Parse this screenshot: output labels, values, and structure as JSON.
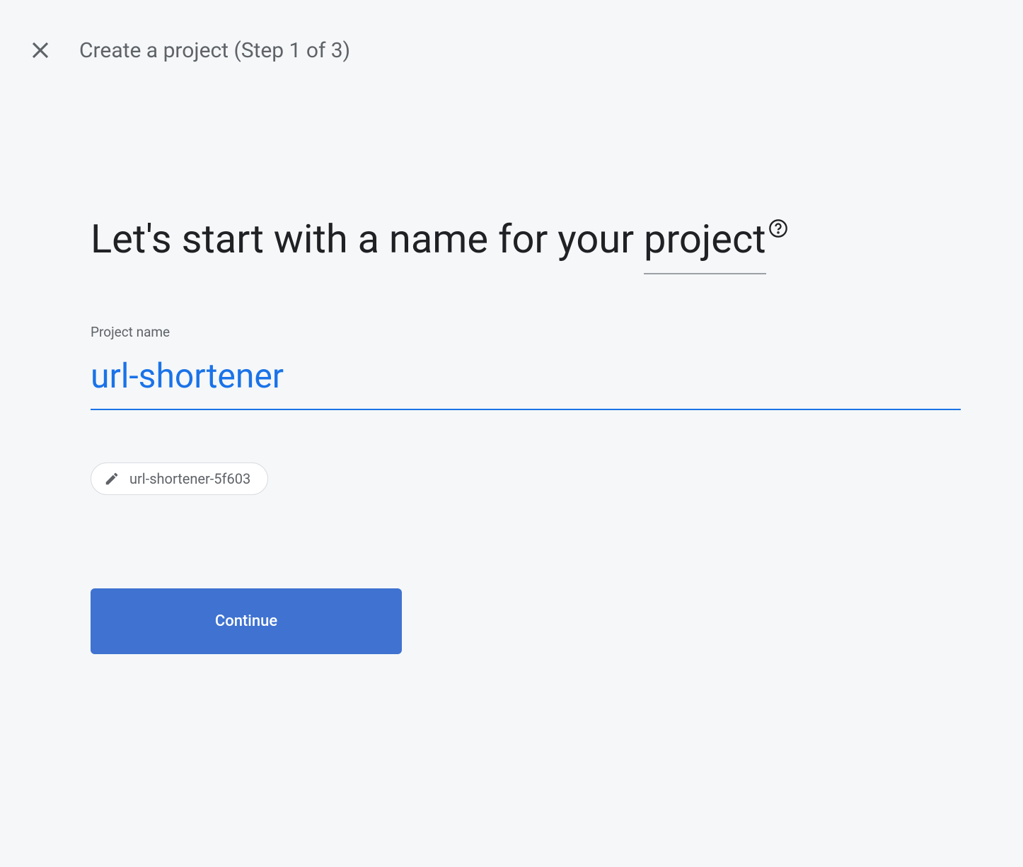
{
  "header": {
    "title": "Create a project (Step 1 of 3)"
  },
  "heading": {
    "prefix": "Let's start with a name for your ",
    "project_word": "project"
  },
  "field": {
    "label": "Project name",
    "value": "url-shortener"
  },
  "chip": {
    "project_id": "url-shortener-5f603"
  },
  "button": {
    "continue": "Continue"
  }
}
